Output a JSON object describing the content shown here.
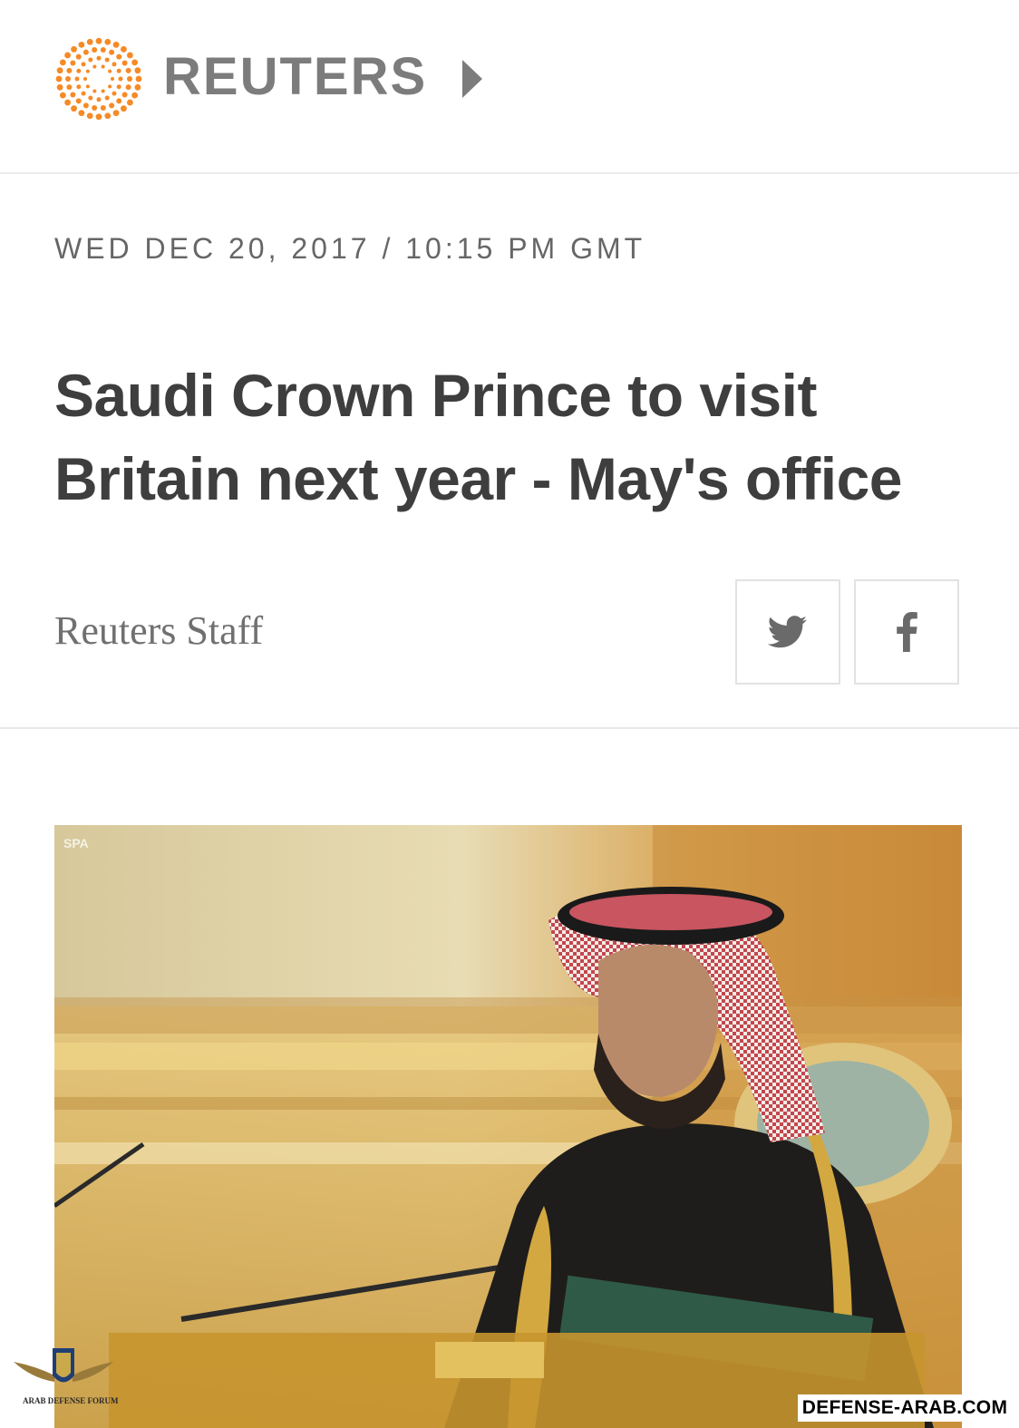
{
  "header": {
    "brand_name": "REUTERS",
    "logo_icon": "reuters-dot-ring-logo",
    "brand_color": "#f68a25",
    "nav_icon": "play-arrow-icon"
  },
  "article": {
    "dateline": "WED DEC 20, 2017 / 10:15 PM GMT",
    "headline": "Saudi Crown Prince to visit Britain next year - May's office",
    "byline": "Reuters Staff",
    "photo_agency_mark": "SPA"
  },
  "share": {
    "buttons": [
      {
        "icon": "twitter-bird-icon"
      },
      {
        "icon": "facebook-f-icon"
      }
    ]
  },
  "overlay": {
    "forum_name": "ARAB DEFENSE FORUM",
    "watermark": "DEFENSE-ARAB.COM"
  }
}
